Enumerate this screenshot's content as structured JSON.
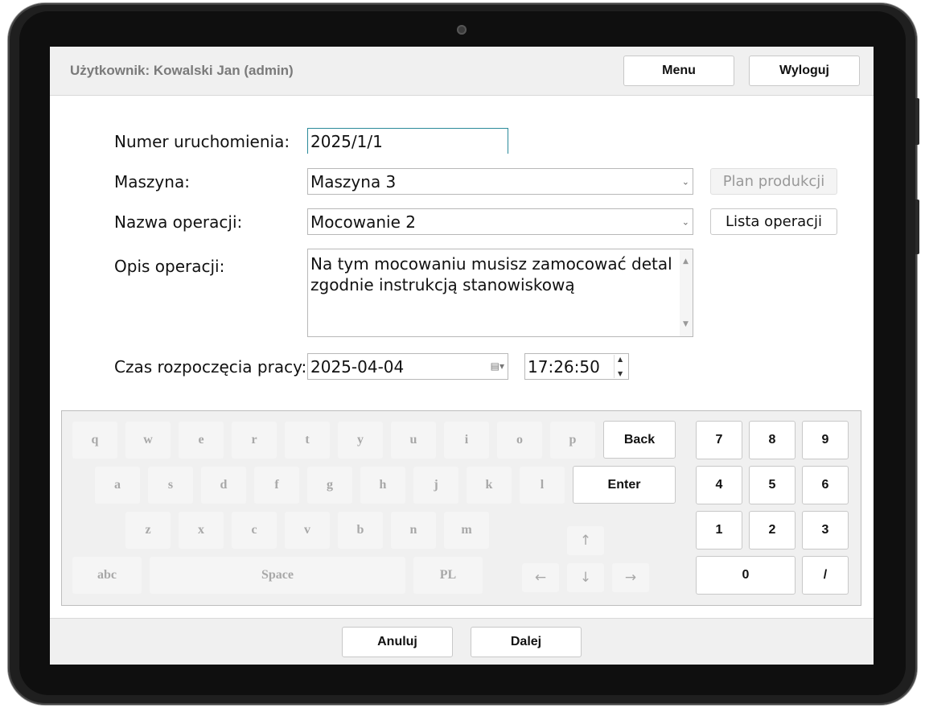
{
  "header": {
    "user_label": "Użytkownik: Kowalski Jan (admin)",
    "menu_button": "Menu",
    "logout_button": "Wyloguj"
  },
  "form": {
    "run_number": {
      "label": "Numer uruchomienia:",
      "value": "2025/1/1"
    },
    "machine": {
      "label": "Maszyna:",
      "value": "Maszyna 3",
      "side_button": "Plan produkcji"
    },
    "operation_name": {
      "label": "Nazwa operacji:",
      "value": "Mocowanie 2",
      "side_button": "Lista operacji"
    },
    "operation_description": {
      "label": "Opis operacji:",
      "value": "Na tym mocowaniu musisz zamocować detal\nzgodnie instrukcją stanowiskową"
    },
    "start_time": {
      "label": "Czas rozpoczęcia pracy:",
      "date": "2025-04-04",
      "time": "17:26:50"
    }
  },
  "keyboard": {
    "row1": [
      "q",
      "w",
      "e",
      "r",
      "t",
      "y",
      "u",
      "i",
      "o",
      "p"
    ],
    "row2": [
      "a",
      "s",
      "d",
      "f",
      "g",
      "h",
      "j",
      "k",
      "l"
    ],
    "row3": [
      "z",
      "x",
      "c",
      "v",
      "b",
      "n",
      "m"
    ],
    "back": "Back",
    "enter": "Enter",
    "abc": "abc",
    "space": "Space",
    "pl": "PL",
    "arrows": {
      "up": "↑",
      "left": "←",
      "down": "↓",
      "right": "→"
    },
    "numpad": [
      "7",
      "8",
      "9",
      "4",
      "5",
      "6",
      "1",
      "2",
      "3"
    ],
    "zero": "0",
    "slash": "/"
  },
  "footer": {
    "cancel_button": "Anuluj",
    "next_button": "Dalej"
  }
}
